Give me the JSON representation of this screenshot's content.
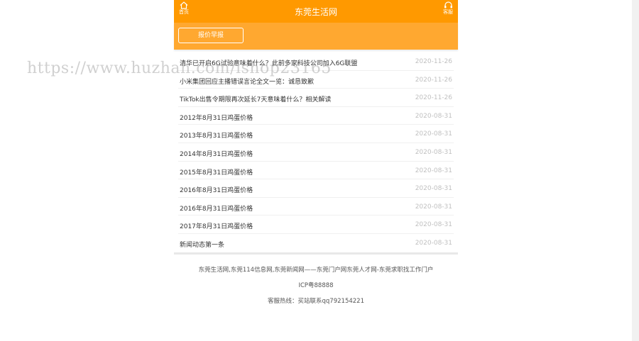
{
  "header": {
    "title": "东莞生活网",
    "home_label": "首页",
    "service_label": "客服",
    "accent_color": "#ff9900"
  },
  "subnav": {
    "button_label": "报价早报"
  },
  "news": [
    {
      "title": "清华已开启6G试验意味着什么？此前多家科技公司加入6G联盟",
      "date": "2020-11-26"
    },
    {
      "title": "小米集团回应主播错误言论全文一览：诚恳致歉",
      "date": "2020-11-26"
    },
    {
      "title": "TikTok出售令期限再次延长7天意味着什么？相关解读",
      "date": "2020-11-26"
    },
    {
      "title": "2012年8月31日鸡蛋价格",
      "date": "2020-08-31"
    },
    {
      "title": "2013年8月31日鸡蛋价格",
      "date": "2020-08-31"
    },
    {
      "title": "2014年8月31日鸡蛋价格",
      "date": "2020-08-31"
    },
    {
      "title": "2015年8月31日鸡蛋价格",
      "date": "2020-08-31"
    },
    {
      "title": "2016年8月31日鸡蛋价格",
      "date": "2020-08-31"
    },
    {
      "title": "2016年8月31日鸡蛋价格",
      "date": "2020-08-31"
    },
    {
      "title": "2017年8月31日鸡蛋价格",
      "date": "2020-08-31"
    },
    {
      "title": "新闻动态第一条",
      "date": "2020-08-31"
    }
  ],
  "watermark": "https://www.huzhan.com/ishop23165",
  "footer": {
    "links": "东莞生活网,东莞114信息网,东莞新闻网——东莞门户网东莞人才网-东莞求职找工作门户",
    "icp": "ICP粤88888",
    "hotline": "客服热线：买站联系qq792154221"
  }
}
